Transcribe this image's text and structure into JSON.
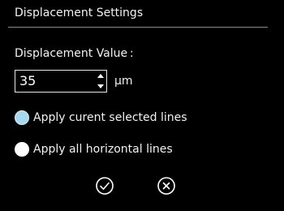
{
  "dialog": {
    "title": "Displacement Settings"
  },
  "displacement": {
    "label": "Displacement Value :",
    "value": "35",
    "unit": "µm"
  },
  "apply_options": [
    {
      "label": "Apply curent selected lines",
      "selected": true
    },
    {
      "label": "Apply all horizontal lines",
      "selected": false
    }
  ],
  "actions": {
    "confirm_icon": "check-circle-icon",
    "cancel_icon": "x-circle-icon"
  },
  "colors": {
    "background": "#000000",
    "selected_radio": "#a7d8ee",
    "text": "#f2f2f2"
  }
}
